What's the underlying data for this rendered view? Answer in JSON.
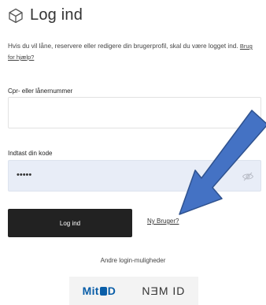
{
  "page": {
    "title": "Log ind"
  },
  "intro": {
    "text": "Hvis du vil låne, reservere eller redigere din brugerprofil, skal du være logget ind.",
    "help_link": "Brug for hjælp?"
  },
  "cpr_field": {
    "label": "Cpr- eller lånernummer",
    "value": "",
    "placeholder": ""
  },
  "password_field": {
    "label": "Indtast din kode",
    "masked_value": "•••••"
  },
  "actions": {
    "login_label": "Log ind",
    "new_user_label": "Ny Bruger?"
  },
  "other": {
    "heading": "Andre login-muligheder",
    "mitid_label": "Mit■D",
    "nemid_label": "NƎM ID"
  },
  "colors": {
    "arrow": "#4472C4",
    "arrow_outline": "#2F528F",
    "button": "#222222",
    "password_bg": "#e8edf7"
  },
  "icons": {
    "header": "cube-icon",
    "password_toggle": "eye-off-icon"
  }
}
